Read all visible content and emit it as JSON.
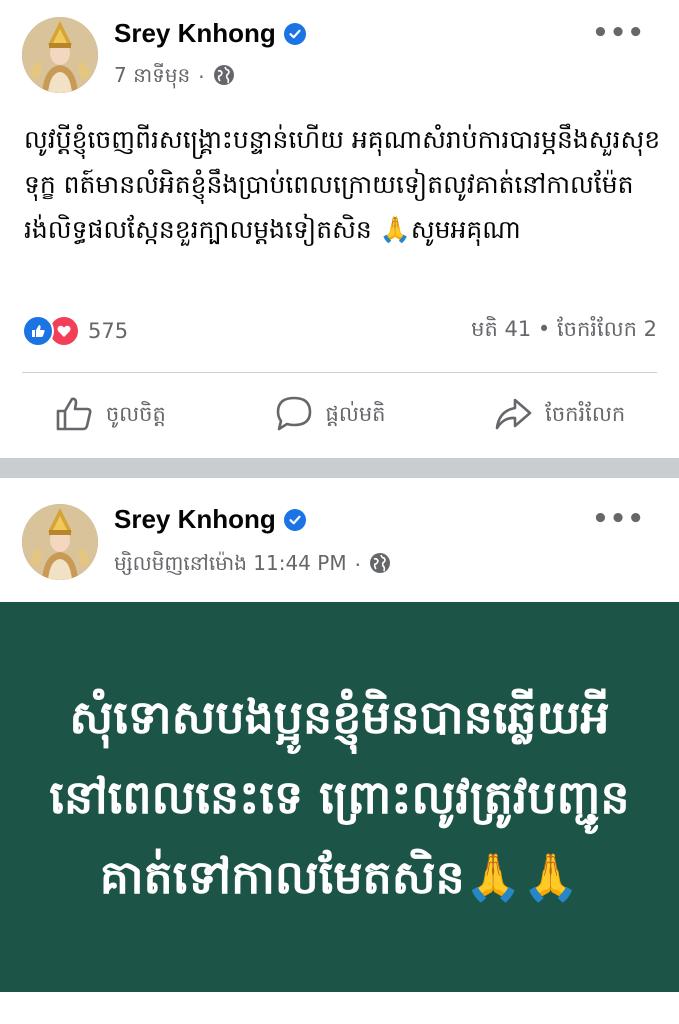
{
  "post1": {
    "author": "Srey Knhong",
    "time": "7 នាទីមុន",
    "dot": "·",
    "text": "លូវប្តីខ្ញុំចេញពីរសង្គ្រោះបន្ទាន់ហើយ អគុណាសំរាប់ការ​បារម្ភនឹងសួរសុខទុក្ខ ពត៍មានលំអិតខ្ញុំនឹងប្រាប់ពេលក្រោយ​ទៀតលូវគាត់នៅកាលម៉ែត រង់លិទ្ធផលស្កែនខួរក្បាលម្តង​ទៀតសិន 🙏សូមអគុណា",
    "reaction_count": "575",
    "comments": "មតិ 41",
    "shares": "ចែករំលែក 2",
    "stat_sep": "•",
    "actions": {
      "like": "ចូលចិត្ត",
      "comment": "ផ្តល់មតិ",
      "share": "ចែករំលែក"
    }
  },
  "post2": {
    "author": "Srey Knhong",
    "time": "ម្សិលមិញនៅម៉ោង 11:44 PM",
    "dot": "·",
    "card_text": "សុំទោសបងប្អូនខ្ញុំមិនបានឆ្លើយអីនៅពេលនេះទេ ព្រោះលូវត្រូវបញ្ជូនគាត់ទៅកាលមែតសិន🙏🙏"
  },
  "colors": {
    "verified": "#1b74e4",
    "like": "#1b74e4",
    "love": "#f33e58",
    "card_bg": "#1d5448",
    "separator": "#c9ccd1"
  },
  "icons": [
    "verified-icon",
    "globe-icon",
    "more-icon",
    "like-reaction-icon",
    "love-reaction-icon",
    "thumbs-up-icon",
    "comment-icon",
    "share-icon"
  ]
}
